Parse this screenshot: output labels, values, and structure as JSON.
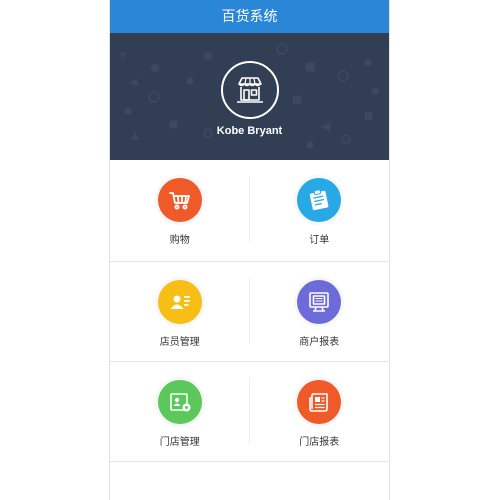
{
  "header": {
    "title": "百货系统"
  },
  "profile": {
    "name": "Kobe Bryant",
    "logo_icon": "storefront-icon"
  },
  "menu": [
    {
      "label": "购物",
      "icon": "shopping-cart-icon",
      "color": "#f05a29"
    },
    {
      "label": "订单",
      "icon": "order-clipboard-icon",
      "color": "#27a9e6"
    },
    {
      "label": "店员管理",
      "icon": "staff-card-icon",
      "color": "#f7be16"
    },
    {
      "label": "商户报表",
      "icon": "monitor-report-icon",
      "color": "#6d6bd9"
    },
    {
      "label": "门店管理",
      "icon": "store-settings-icon",
      "color": "#5ac85a"
    },
    {
      "label": "门店报表",
      "icon": "newspaper-report-icon",
      "color": "#f05a29"
    }
  ],
  "colors": {
    "titlebar": "#2a87d8",
    "hero_bg": "#323e54"
  }
}
